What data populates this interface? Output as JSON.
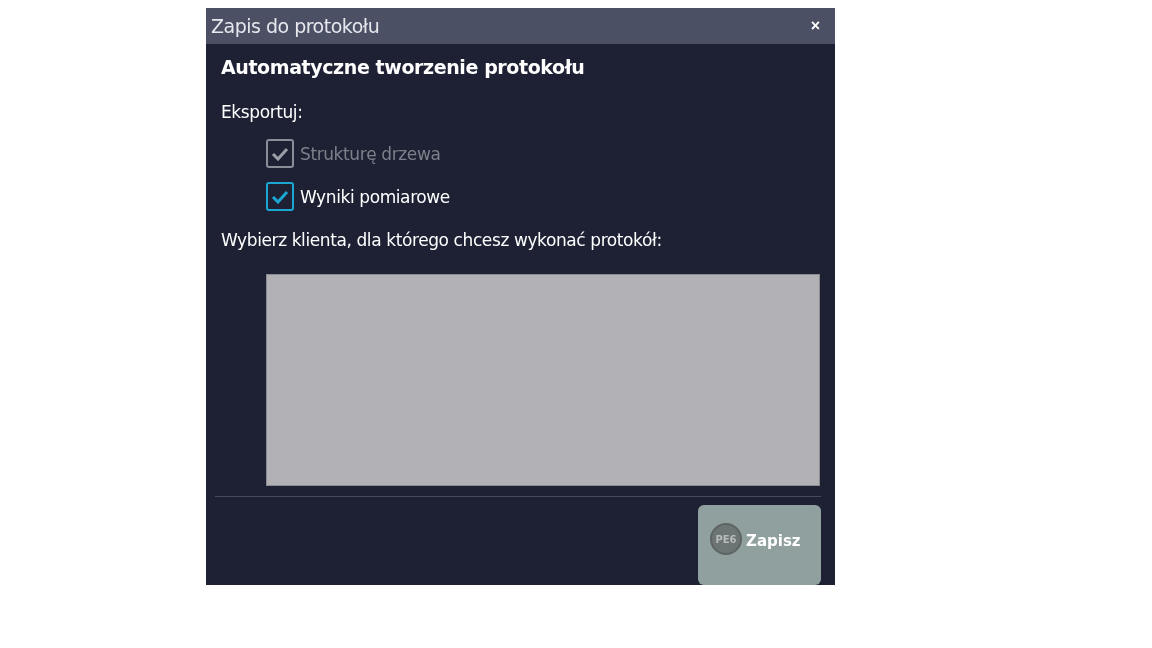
{
  "window": {
    "title": "Zapis do protokołu",
    "close": "×"
  },
  "heading": "Automatyczne tworzenie protokołu",
  "export_label": "Eksportuj:",
  "options": [
    {
      "label": "Strukturę drzewa",
      "checked": true,
      "disabled": true
    },
    {
      "label": "Wyniki pomiarowe",
      "checked": true,
      "disabled": false
    }
  ],
  "client_prompt": "Wybierz klienta, dla którego chcesz wykonać protokół:",
  "save_button": {
    "logo": "PE6",
    "label": "Zapisz"
  }
}
